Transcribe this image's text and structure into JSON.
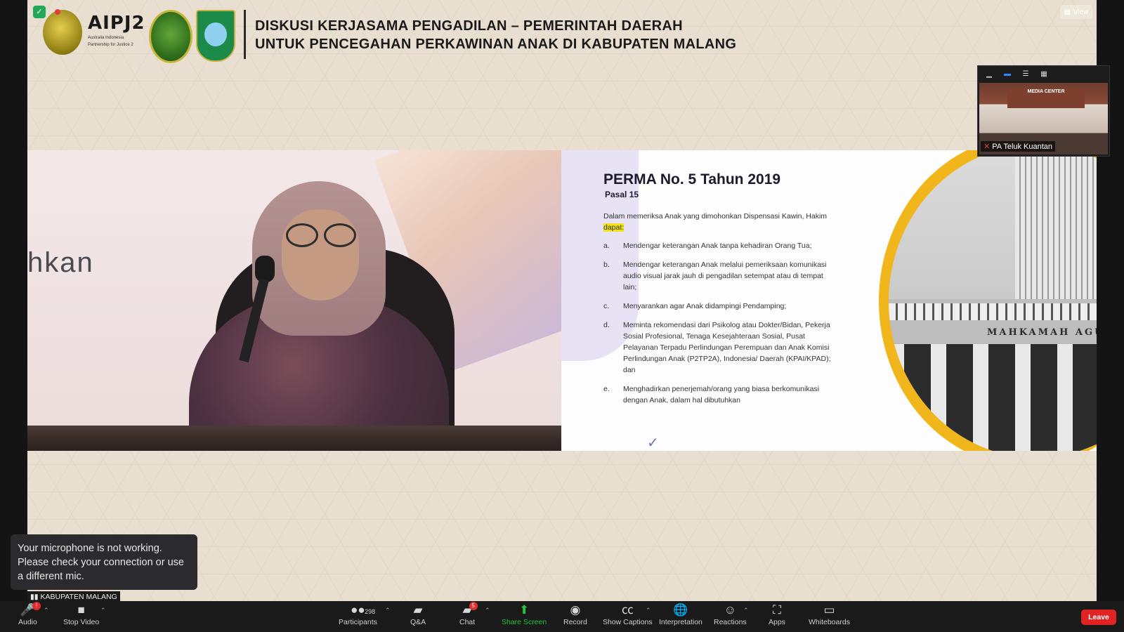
{
  "banner": {
    "title_line1": "DISKUSI KERJASAMA PENGADILAN – PEMERINTAH DAERAH",
    "title_line2": "UNTUK PENCEGAHAN PERKAWINAN ANAK DI KABUPATEN MALANG",
    "aipj_logo": "AIPJ2",
    "aipj_sub1": "Australia Indonesia",
    "aipj_sub2": "Partnership for Justice 2"
  },
  "video": {
    "side_word": "hkan"
  },
  "slide": {
    "title": "PERMA No. 5 Tahun 2019",
    "subtitle": "Pasal 15",
    "intro_before": "Dalam memeriksa Anak yang dimohonkan Dispensasi Kawin, Hakim",
    "intro_highlight": "dapat:",
    "items": [
      {
        "marker": "a.",
        "text": "Mendengar keterangan Anak tanpa kehadiran Orang Tua;"
      },
      {
        "marker": "b.",
        "text": "Mendengar keterangan Anak melalui pemeriksaan komunikasi audio visual jarak jauh di pengadilan setempat atau di tempat lain;"
      },
      {
        "marker": "c.",
        "text": "Menyarankan agar Anak didampingi Pendamping;"
      },
      {
        "marker": "d.",
        "text": "Meminta rekomendasi dari Psikolog atau Dokter/Bidan, Pekerja Sosial Profesional, Tenaga Kesejahteraan Sosial, Pusat Pelayanan Terpadu Perlindungan Perempuan dan Anak Komisi Perlindungan Anak (P2TP2A), Indonesia/ Daerah (KPAI/KPAD); dan"
      },
      {
        "marker": "e.",
        "text": "Menghadirkan penerjemah/orang yang biasa berkomunikasi dengan Anak, dalam hal dibutuhkan"
      }
    ],
    "building_label": "MAHKAMAH AGUNG"
  },
  "pip": {
    "participant_name": "PA Teluk Kuantan",
    "banner_text": "MEDIA CENTER"
  },
  "view_button": "View",
  "toast": {
    "message": "Your microphone is not working. Please check your connection or use a different mic."
  },
  "name_tag": "KABUPATEN MALANG",
  "toolbar": {
    "audio": "Audio",
    "audio_badge": "!",
    "stop_video": "Stop Video",
    "participants": "Participants",
    "participants_count": "298",
    "qa": "Q&A",
    "chat": "Chat",
    "chat_badge": "5",
    "share_screen": "Share Screen",
    "record": "Record",
    "show_captions": "Show Captions",
    "interpretation": "Interpretation",
    "reactions": "Reactions",
    "apps": "Apps",
    "whiteboards": "Whiteboards",
    "leave": "Leave"
  },
  "colors": {
    "toolbar_bg": "#1a1a1a",
    "leave_red": "#e02424",
    "share_green": "#24c43b",
    "highlight_yellow": "#f3e11b",
    "ring_orange": "#f1b61b"
  }
}
